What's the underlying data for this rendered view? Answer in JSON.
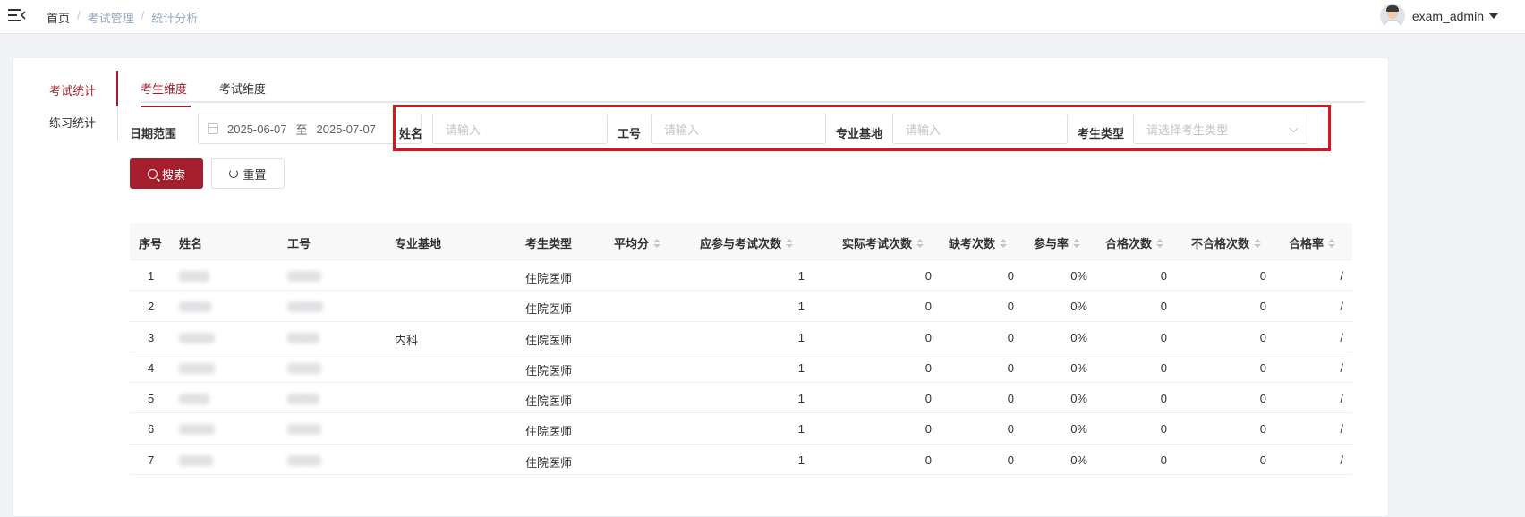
{
  "breadcrumb": {
    "home": "首页",
    "items": [
      "考试管理",
      "统计分析"
    ],
    "separator": "/"
  },
  "user": {
    "name": "exam_admin"
  },
  "sidenav": {
    "items": [
      {
        "label": "考试统计",
        "active": true
      },
      {
        "label": "练习统计",
        "active": false
      }
    ]
  },
  "tabs": [
    {
      "label": "考生维度",
      "active": true
    },
    {
      "label": "考试维度",
      "active": false
    }
  ],
  "filters": {
    "date_label": "日期范围",
    "date_start": "2025-06-07",
    "date_sep": "至",
    "date_end": "2025-07-07",
    "name_label": "姓名",
    "name_placeholder": "请输入",
    "id_label": "工号",
    "id_placeholder": "请输入",
    "base_label": "专业基地",
    "base_placeholder": "请输入",
    "type_label": "考生类型",
    "type_placeholder": "请选择考生类型"
  },
  "buttons": {
    "search": "搜索",
    "reset": "重置"
  },
  "table": {
    "headers": [
      "序号",
      "姓名",
      "工号",
      "专业基地",
      "考生类型",
      "平均分",
      "应参与考试次数",
      "实际考试次数",
      "缺考次数",
      "参与率",
      "合格次数",
      "不合格次数",
      "合格率"
    ],
    "rows": [
      {
        "no": "1",
        "base": "",
        "type": "住院医师",
        "avg": "",
        "should": "1",
        "actual": "0",
        "absent": "0",
        "rate": "0%",
        "pass": "0",
        "fail": "0",
        "pass_rate": "/"
      },
      {
        "no": "2",
        "base": "",
        "type": "住院医师",
        "avg": "",
        "should": "1",
        "actual": "0",
        "absent": "0",
        "rate": "0%",
        "pass": "0",
        "fail": "0",
        "pass_rate": "/"
      },
      {
        "no": "3",
        "base": "内科",
        "type": "住院医师",
        "avg": "",
        "should": "1",
        "actual": "0",
        "absent": "0",
        "rate": "0%",
        "pass": "0",
        "fail": "0",
        "pass_rate": "/"
      },
      {
        "no": "4",
        "base": "",
        "type": "住院医师",
        "avg": "",
        "should": "1",
        "actual": "0",
        "absent": "0",
        "rate": "0%",
        "pass": "0",
        "fail": "0",
        "pass_rate": "/"
      },
      {
        "no": "5",
        "base": "",
        "type": "住院医师",
        "avg": "",
        "should": "1",
        "actual": "0",
        "absent": "0",
        "rate": "0%",
        "pass": "0",
        "fail": "0",
        "pass_rate": "/"
      },
      {
        "no": "6",
        "base": "",
        "type": "住院医师",
        "avg": "",
        "should": "1",
        "actual": "0",
        "absent": "0",
        "rate": "0%",
        "pass": "0",
        "fail": "0",
        "pass_rate": "/"
      },
      {
        "no": "7",
        "base": "",
        "type": "住院医师",
        "avg": "",
        "should": "1",
        "actual": "0",
        "absent": "0",
        "rate": "0%",
        "pass": "0",
        "fail": "0",
        "pass_rate": "/"
      }
    ]
  },
  "colors": {
    "accent": "#a41e2d",
    "highlight": "#d9161c"
  }
}
